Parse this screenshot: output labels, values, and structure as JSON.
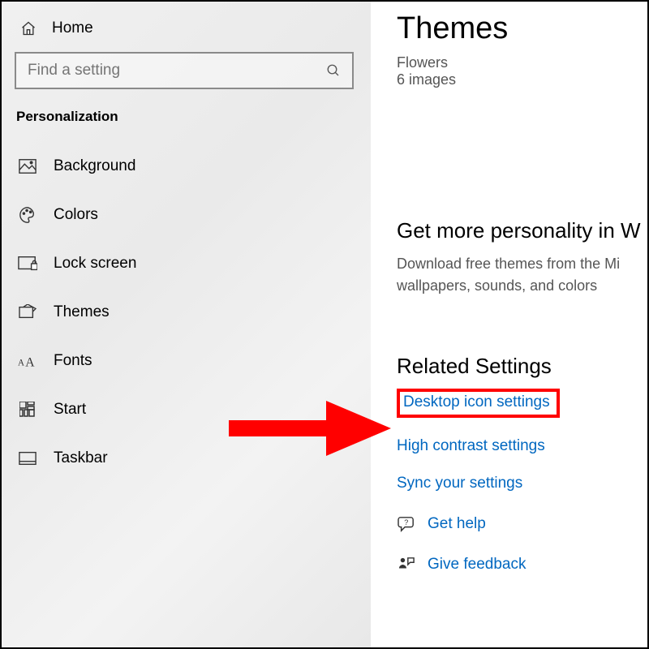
{
  "sidebar": {
    "home": "Home",
    "search_placeholder": "Find a setting",
    "section": "Personalization",
    "items": [
      {
        "label": "Background"
      },
      {
        "label": "Colors"
      },
      {
        "label": "Lock screen"
      },
      {
        "label": "Themes"
      },
      {
        "label": "Fonts"
      },
      {
        "label": "Start"
      },
      {
        "label": "Taskbar"
      }
    ]
  },
  "main": {
    "title": "Themes",
    "theme_name": "Flowers",
    "theme_count": "6 images",
    "store_heading": "Get more personality in W",
    "store_body": "Download free themes from the Mi wallpapers, sounds, and colors",
    "related_heading": "Related Settings",
    "links": {
      "desktop_icon": "Desktop icon settings",
      "high_contrast": "High contrast settings",
      "sync": "Sync your settings",
      "help": "Get help",
      "feedback": "Give feedback"
    }
  },
  "colors": {
    "link": "#0067c0",
    "highlight": "#ff0000"
  }
}
